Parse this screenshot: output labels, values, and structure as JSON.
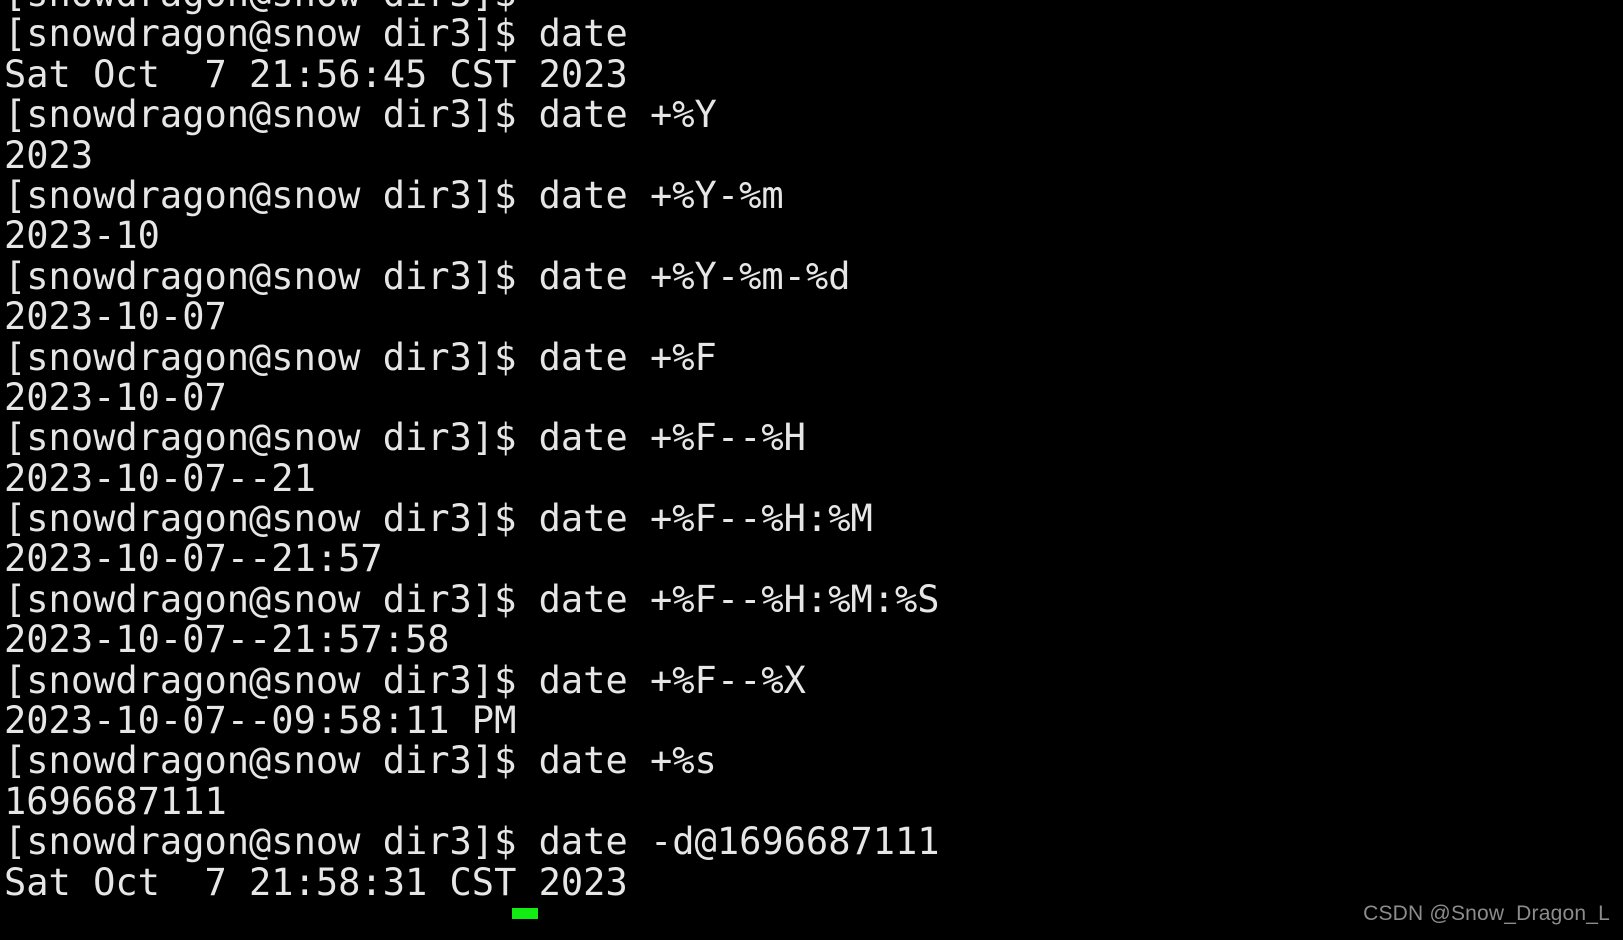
{
  "terminal": {
    "background_color": "#000000",
    "foreground_color": "#e6e6e6",
    "cursor_color": "#12ec12",
    "prompt": "[snowdragon@snow dir3]$",
    "lines": [
      {
        "type": "prompt",
        "text": "[snowdragon@snow dir3]$"
      },
      {
        "type": "prompt",
        "text": "[snowdragon@snow dir3]$ date"
      },
      {
        "type": "output",
        "text": "Sat Oct  7 21:56:45 CST 2023"
      },
      {
        "type": "prompt",
        "text": "[snowdragon@snow dir3]$ date +%Y"
      },
      {
        "type": "output",
        "text": "2023"
      },
      {
        "type": "prompt",
        "text": "[snowdragon@snow dir3]$ date +%Y-%m"
      },
      {
        "type": "output",
        "text": "2023-10"
      },
      {
        "type": "prompt",
        "text": "[snowdragon@snow dir3]$ date +%Y-%m-%d"
      },
      {
        "type": "output",
        "text": "2023-10-07"
      },
      {
        "type": "prompt",
        "text": "[snowdragon@snow dir3]$ date +%F"
      },
      {
        "type": "output",
        "text": "2023-10-07"
      },
      {
        "type": "prompt",
        "text": "[snowdragon@snow dir3]$ date +%F--%H"
      },
      {
        "type": "output",
        "text": "2023-10-07--21"
      },
      {
        "type": "prompt",
        "text": "[snowdragon@snow dir3]$ date +%F--%H:%M"
      },
      {
        "type": "output",
        "text": "2023-10-07--21:57"
      },
      {
        "type": "prompt",
        "text": "[snowdragon@snow dir3]$ date +%F--%H:%M:%S"
      },
      {
        "type": "output",
        "text": "2023-10-07--21:57:58"
      },
      {
        "type": "prompt",
        "text": "[snowdragon@snow dir3]$ date +%F--%X"
      },
      {
        "type": "output",
        "text": "2023-10-07--09:58:11 PM"
      },
      {
        "type": "prompt",
        "text": "[snowdragon@snow dir3]$ date +%s"
      },
      {
        "type": "output",
        "text": "1696687111"
      },
      {
        "type": "prompt",
        "text": "[snowdragon@snow dir3]$ date -d@1696687111"
      },
      {
        "type": "output",
        "text": "Sat Oct  7 21:58:31 CST 2023"
      }
    ]
  },
  "watermark": {
    "text": "CSDN @Snow_Dragon_L",
    "color": "#8c8c8c"
  }
}
